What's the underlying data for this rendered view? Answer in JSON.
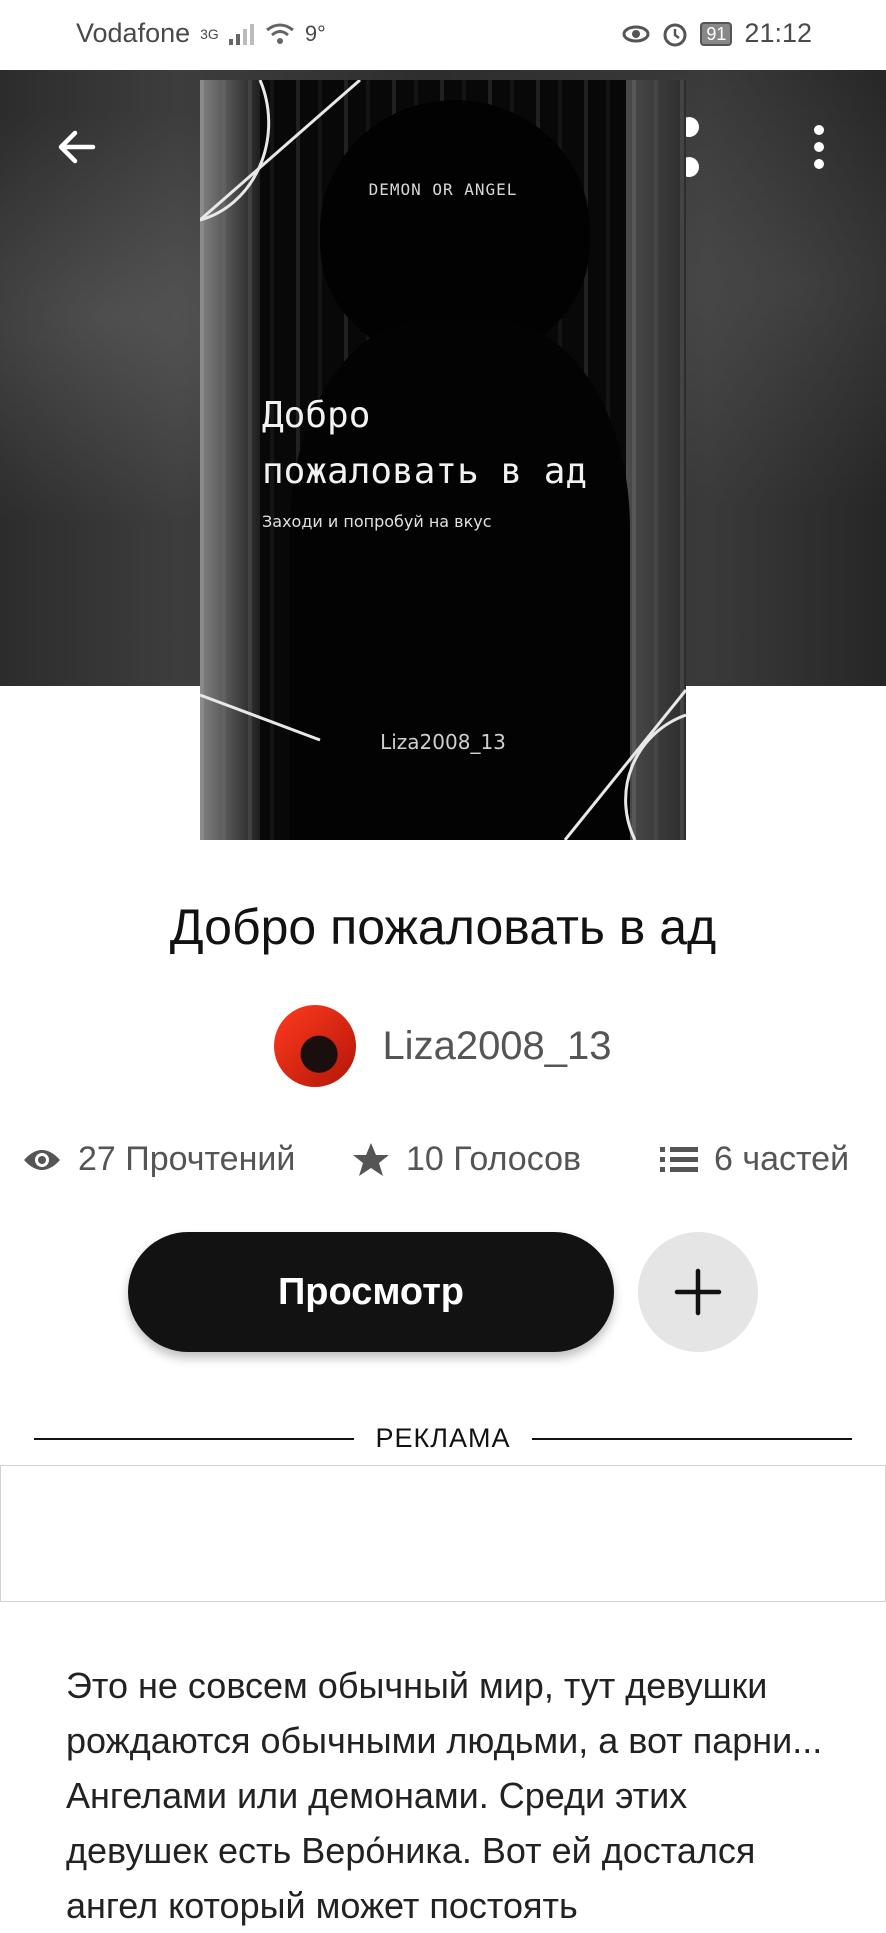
{
  "status_bar": {
    "carrier": "Vodafone",
    "network": "3G",
    "temperature": "9°",
    "battery": "91",
    "time": "21:12"
  },
  "cover": {
    "tagline": "DEMON OR ANGEL",
    "title_line1": "Добро",
    "title_line2": "пожаловать в ад",
    "subtitle": "Заходи и попробуй на вкус",
    "author": "Liza2008_13"
  },
  "book": {
    "title": "Добро пожаловать в ад",
    "author": "Liza2008_13"
  },
  "stats": {
    "reads": "27 Прочтений",
    "votes": "10 Голосов",
    "parts": "6 частей"
  },
  "actions": {
    "read_label": "Просмотр"
  },
  "ad": {
    "label": "РЕКЛАМА"
  },
  "description": "Это не совсем обычный мир, тут девушки рождаются обычными людьми, а вот парни... Ангелами или демонами. Среди этих девушек есть Веро́ника. Вот ей достался ангел который может постоять",
  "colors": {
    "primary_button": "#121212",
    "secondary_button": "#e6e5e6",
    "text_muted": "#555555"
  }
}
